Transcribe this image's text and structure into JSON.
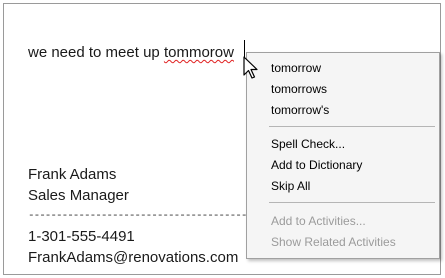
{
  "editor": {
    "line1_prefix": "we need to meet up ",
    "line1_misspelled": "tommorow",
    "signature_name": "Frank Adams",
    "signature_title": "Sales Manager",
    "divider": "-----------------------------------------------",
    "phone": "1-301-555-4491",
    "email": "FrankAdams@renovations.com"
  },
  "context_menu": {
    "suggestions": [
      "tomorrow",
      "tomorrows",
      "tomorrow's"
    ],
    "spell_check": "Spell Check...",
    "add_to_dictionary": "Add to Dictionary",
    "skip_all": "Skip All",
    "add_to_activities": "Add to Activities...",
    "show_related_activities": "Show Related Activities"
  },
  "icons": {
    "cursor": "mouse-pointer-icon"
  }
}
